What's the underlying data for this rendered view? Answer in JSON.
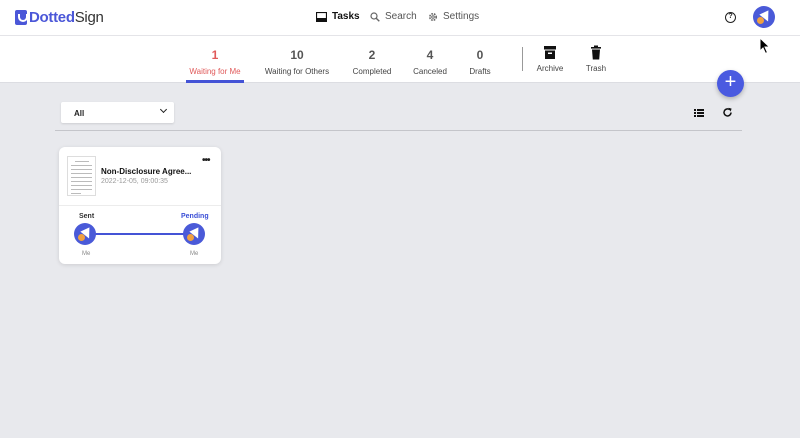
{
  "app": {
    "name_prefix": "",
    "name_brand": "Dotted",
    "name_suffix": "Sign"
  },
  "nav": {
    "tasks": {
      "label": "Tasks",
      "icon": "inbox-icon",
      "active": true
    },
    "search": {
      "label": "Search",
      "icon": "search-icon"
    },
    "settings": {
      "label": "Settings",
      "icon": "gear-icon"
    }
  },
  "header": {
    "help_glyph": "?",
    "avatar": "user-avatar"
  },
  "tabs": [
    {
      "count": "1",
      "label": "Waiting for Me",
      "active": true
    },
    {
      "count": "10",
      "label": "Waiting for Others"
    },
    {
      "count": "2",
      "label": "Completed"
    },
    {
      "count": "4",
      "label": "Canceled"
    },
    {
      "count": "0",
      "label": "Drafts"
    }
  ],
  "extra_tabs": [
    {
      "label": "Archive",
      "icon": "archive-icon"
    },
    {
      "label": "Trash",
      "icon": "trash-icon"
    }
  ],
  "fab": {
    "glyph": "+"
  },
  "filter": {
    "selected": "All"
  },
  "document": {
    "title": "Non-Disclosure Agree...",
    "date": "2022-12-05, 09:00:35",
    "more_glyph": "•••",
    "steps": [
      {
        "status": "Sent",
        "who": "Me",
        "status_color": "#333333"
      },
      {
        "status": "Pending",
        "who": "Me",
        "status_color": "#3b4fd6"
      }
    ]
  },
  "colors": {
    "accent": "#4453d6",
    "active_tab": "#e05a5a",
    "background": "#e8e9ed"
  }
}
